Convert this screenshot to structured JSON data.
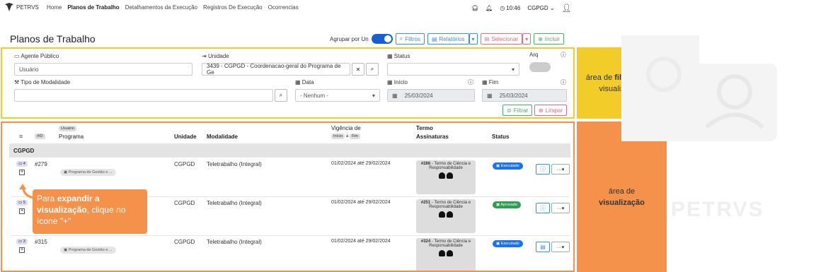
{
  "nav": {
    "logo_text": "PETRVS",
    "links": [
      "Home",
      "Planos de Trabalho",
      "Detalhamentos da Execução",
      "Registros De Execução",
      "Ocorrencias"
    ],
    "time": "10:46",
    "unit": "CGPGD"
  },
  "page": {
    "title": "Planos de Trabalho",
    "group_label": "Agrupar por Un",
    "filters_btn": "Filtros",
    "reports_btn": "Relatórios",
    "select_btn": "Selecionar",
    "include_btn": "Incluir"
  },
  "filters": {
    "agente_label": "Agente Público",
    "agente_placeholder": "Usuário",
    "unidade_label": "Unidade",
    "unidade_value": "3439 - CGPGD - Coordenacao-geral do Programa de Ge",
    "status_label": "Status",
    "arq_label": "Arq",
    "modalidade_label": "Tipo de Modalidade",
    "data_label": "Data",
    "data_value": "- Nenhum -",
    "inicio_label": "Início",
    "inicio_value": "25/03/2024",
    "fim_label": "Fim",
    "fim_value": "25/03/2024",
    "filtrar_btn": "Filtrar",
    "limpar_btn": "Limpar"
  },
  "table": {
    "usuario_pill": "Usuário",
    "id_pill": "#ID",
    "col_programa": "Programa",
    "col_unidade": "Unidade",
    "col_modalidade": "Modalidade",
    "col_vigencia": "Vigência de",
    "vig_inicio": "Início",
    "vig_a": "a",
    "vig_fim": "Fim",
    "col_termo": "Termo",
    "col_assinaturas": "Assinaturas",
    "col_status": "Status",
    "group": "CGPGD",
    "rows": [
      {
        "count": "4",
        "id": "#279",
        "programa": "Programa de Gestão e ...",
        "unidade": "CGPGD",
        "modalidade": "Teletrabalho (Integral)",
        "vigencia": "01/02/2024 até 29/02/2024",
        "termo_num": "#286",
        "termo_text": "- Termo de Ciência e Responsabilidade",
        "status": "Executado",
        "status_color": "#1a73e8"
      },
      {
        "count": "5",
        "id": "",
        "programa": "",
        "unidade": "CGPGD",
        "modalidade": "Teletrabalho (Integral)",
        "vigencia": "01/02/2024 até 29/02/2024",
        "termo_num": "#251",
        "termo_text": "- Termo de Ciência e Responsabilidade",
        "status": "Aprovado",
        "status_color": "#2e9e4f"
      },
      {
        "count": "3",
        "id": "#315",
        "programa": "Programa de Gestão e ...",
        "unidade": "CGPGD",
        "modalidade": "Teletrabalho (Integral)",
        "vigencia": "01/02/2024 até 29/02/2024",
        "termo_num": "#324",
        "termo_text": "- Termo de Ciência e Responsabilidade",
        "status": "Executado",
        "status_color": "#1a73e8"
      }
    ]
  },
  "callouts": {
    "filters_pre": "área de ",
    "filters_bold": "filtros para",
    "filters_post": " visualização",
    "view_pre": "área de",
    "view_bold": "visualização",
    "tip_1": "Para ",
    "tip_2": "expandir a visualização",
    "tip_3": ", clique no ícone \"+\""
  },
  "watermark": "PETRVS"
}
